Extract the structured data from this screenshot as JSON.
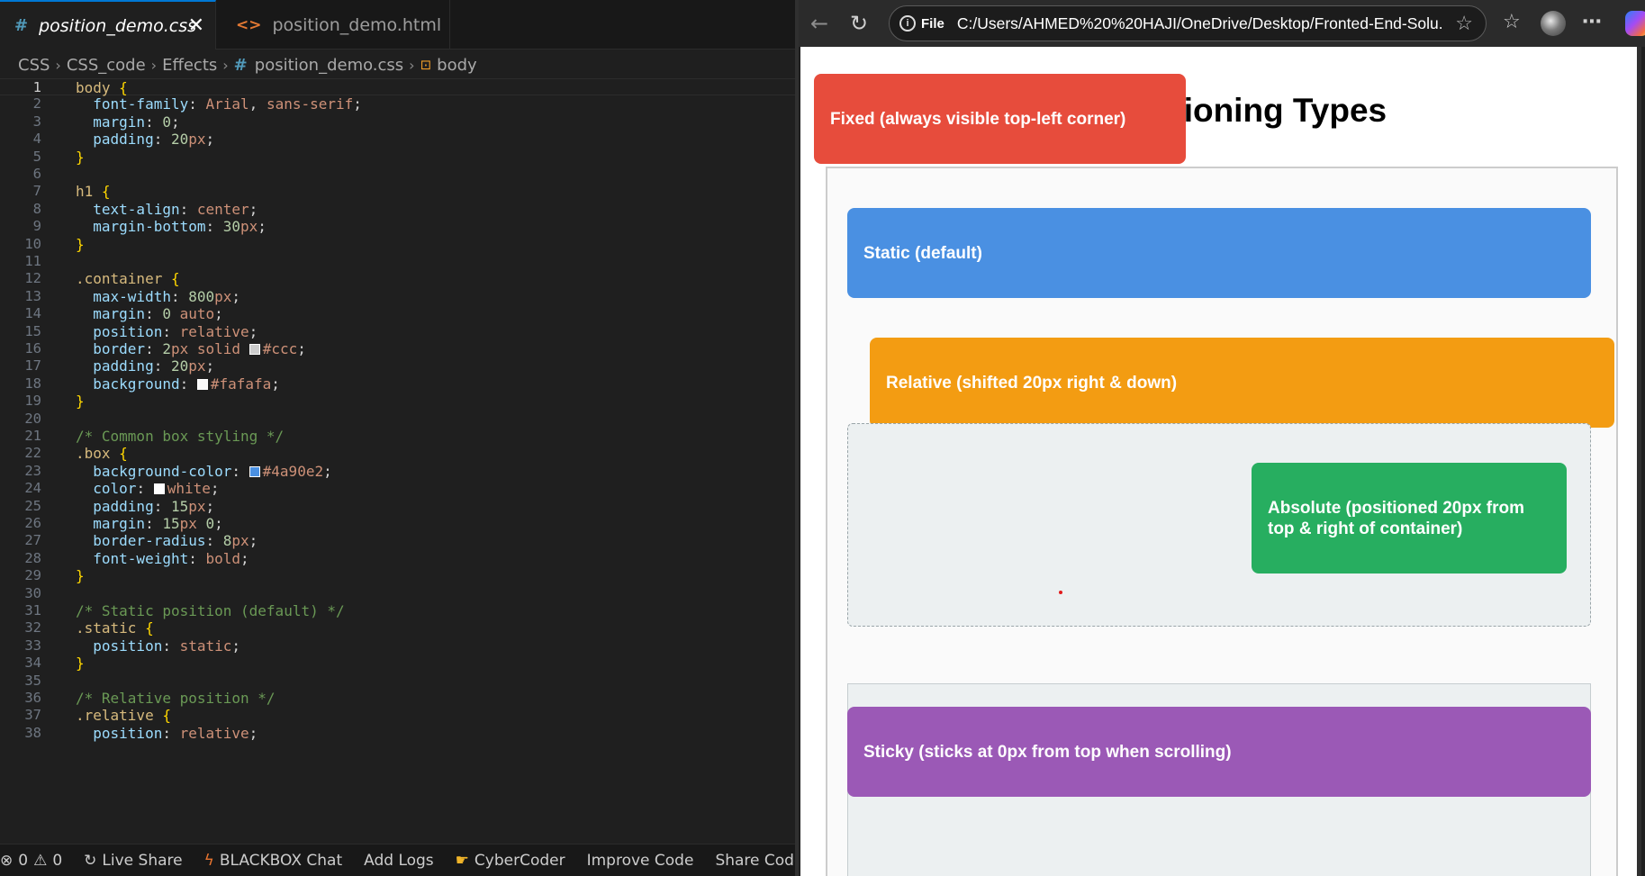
{
  "editor": {
    "tabs": [
      {
        "icon": "#",
        "label": "position_demo.css",
        "close": "✕"
      },
      {
        "icon": "<>",
        "label": "position_demo.html"
      }
    ],
    "breadcrumb": [
      "CSS",
      "CSS_code",
      "Effects",
      "position_demo.css",
      "body"
    ],
    "code_lines": [
      {
        "n": "1",
        "text": "body {"
      },
      {
        "n": "2",
        "text": "  font-family: Arial, sans-serif;"
      },
      {
        "n": "3",
        "text": "  margin: 0;"
      },
      {
        "n": "4",
        "text": "  padding: 20px;"
      },
      {
        "n": "5",
        "text": "}"
      },
      {
        "n": "6",
        "text": ""
      },
      {
        "n": "7",
        "text": "h1 {"
      },
      {
        "n": "8",
        "text": "  text-align: center;"
      },
      {
        "n": "9",
        "text": "  margin-bottom: 30px;"
      },
      {
        "n": "10",
        "text": "}"
      },
      {
        "n": "11",
        "text": ""
      },
      {
        "n": "12",
        "text": ".container {"
      },
      {
        "n": "13",
        "text": "  max-width: 800px;"
      },
      {
        "n": "14",
        "text": "  margin: 0 auto;"
      },
      {
        "n": "15",
        "text": "  position: relative;"
      },
      {
        "n": "16",
        "text": "  border: 2px solid #ccc;"
      },
      {
        "n": "17",
        "text": "  padding: 20px;"
      },
      {
        "n": "18",
        "text": "  background: #fafafa;"
      },
      {
        "n": "19",
        "text": "}"
      },
      {
        "n": "20",
        "text": ""
      },
      {
        "n": "21",
        "text": "/* Common box styling */"
      },
      {
        "n": "22",
        "text": ".box {"
      },
      {
        "n": "23",
        "text": "  background-color: #4a90e2;"
      },
      {
        "n": "24",
        "text": "  color: white;"
      },
      {
        "n": "25",
        "text": "  padding: 15px;"
      },
      {
        "n": "26",
        "text": "  margin: 15px 0;"
      },
      {
        "n": "27",
        "text": "  border-radius: 8px;"
      },
      {
        "n": "28",
        "text": "  font-weight: bold;"
      },
      {
        "n": "29",
        "text": "}"
      },
      {
        "n": "30",
        "text": ""
      },
      {
        "n": "31",
        "text": "/* Static position (default) */"
      },
      {
        "n": "32",
        "text": ".static {"
      },
      {
        "n": "33",
        "text": "  position: static;"
      },
      {
        "n": "34",
        "text": "}"
      },
      {
        "n": "35",
        "text": ""
      },
      {
        "n": "36",
        "text": "/* Relative position */"
      },
      {
        "n": "37",
        "text": ".relative {"
      },
      {
        "n": "38",
        "text": "  position: relative;"
      }
    ],
    "status": {
      "errors": "0",
      "warnings": "0",
      "items": [
        "Live Share",
        "BLACKBOX Chat",
        "Add Logs",
        "CyberCoder",
        "Improve Code",
        "Share Code Link"
      ]
    }
  },
  "browser": {
    "address": {
      "scheme_label": "File",
      "url": "C:/Users/AHMED%20%20HAJI/OneDrive/Desktop/Fronted-End-Solu..."
    },
    "page": {
      "heading": "CSS Positioning Types",
      "boxes": {
        "static": "Static (default)",
        "relative": "Relative (shifted 20px right & down)",
        "absolute": "Absolute (positioned 20px from top & right of container)",
        "sticky": "Sticky (sticks at 0px from top when scrolling)",
        "fixed": "Fixed (always visible top-left corner)"
      }
    }
  },
  "colors": {
    "static": "#4a90e2",
    "relative": "#f39c12",
    "absolute": "#27ae60",
    "sticky": "#9b59b6",
    "fixed": "#e74c3c",
    "container_bg": "#fafafa"
  }
}
